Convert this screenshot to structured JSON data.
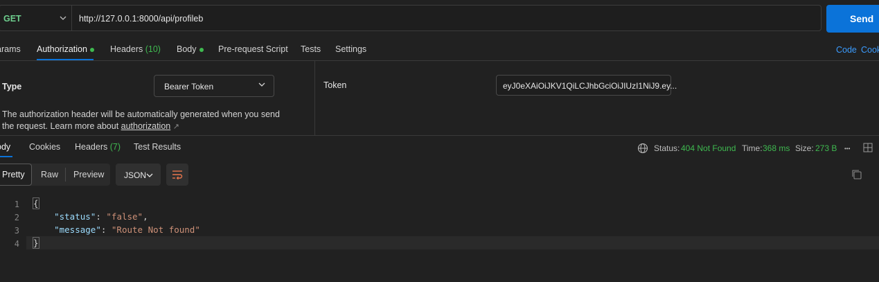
{
  "request": {
    "method": "GET",
    "url": "http://127.0.0.1:8000/api/profileb",
    "send_label": "Send"
  },
  "request_tabs": {
    "params": "arams",
    "authorization": "Authorization",
    "headers": "Headers",
    "headers_count": "(10)",
    "body": "Body",
    "prerequest": "Pre-request Script",
    "tests": "Tests",
    "settings": "Settings",
    "code_link": "Code",
    "cookies_link": "Cook"
  },
  "auth": {
    "type_label": "Type",
    "type_value": "Bearer Token",
    "desc_text": "The authorization header will be automatically generated when you send the request. Learn more about",
    "desc_link": "authorization",
    "desc_arrow": "↗",
    "token_label": "Token",
    "token_value": "eyJ0eXAiOiJKV1QiLCJhbGciOiJIUzI1NiJ9.ey..."
  },
  "response_tabs": {
    "body": "ody",
    "cookies": "Cookies",
    "headers": "Headers",
    "headers_count": "(7)",
    "test_results": "Test Results"
  },
  "response_status": {
    "status_label": "Status:",
    "status_value": "404 Not Found",
    "time_label": "Time:",
    "time_value": "368 ms",
    "size_label": "Size:",
    "size_value": "273 B",
    "more": "•••"
  },
  "view_modes": {
    "pretty": "Pretty",
    "raw": "Raw",
    "preview": "Preview",
    "format": "JSON"
  },
  "code": {
    "line_numbers": [
      "1",
      "2",
      "3",
      "4"
    ],
    "open_brace": "{",
    "close_brace": "}",
    "status_key": "\"status\"",
    "status_val": "\"false\"",
    "message_key": "\"message\"",
    "message_val": "\"Route Not found\""
  },
  "colors": {
    "accent": "#0b73d9",
    "success": "#3fb950",
    "background": "#212121"
  }
}
